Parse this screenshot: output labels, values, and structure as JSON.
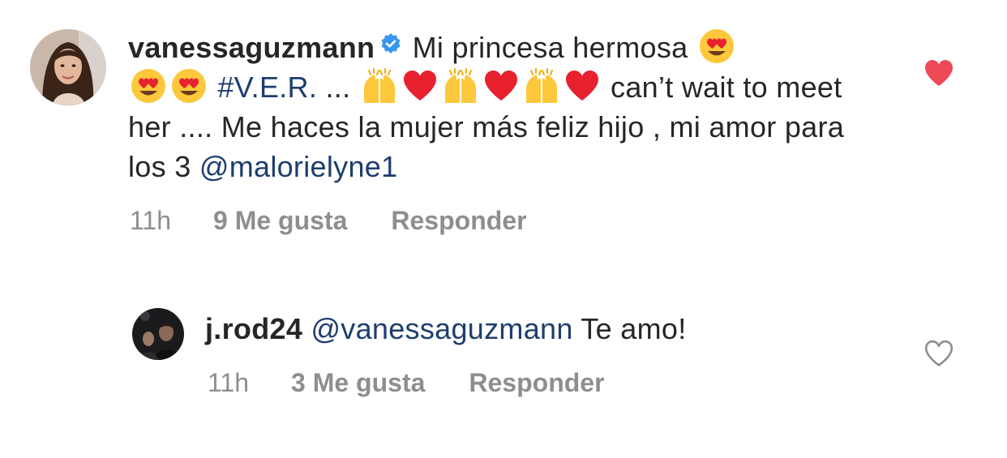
{
  "accent_colors": {
    "mention": "#1c3e6e",
    "meta_text": "#8e8e8e",
    "liked_heart": "#ed4956",
    "verified_badge": "#3897f0"
  },
  "comments": [
    {
      "username": "vanessaguzmann",
      "verified": true,
      "segments": {
        "t1": "Mi princesa hermosa",
        "hashtag": "#V.E.R.",
        "t2": "...",
        "t3": "can’t wait to meet her .... Me haces la mujer más feliz hijo , mi amor para los 3",
        "mention": "@malorielyne1"
      },
      "emoji_icons": [
        "heart-eyes-emoji",
        "raising-hands-emoji",
        "red-heart-emoji"
      ],
      "time": "11h",
      "likes": "9 Me gusta",
      "reply": "Responder",
      "liked": true
    },
    {
      "username": "j.rod24",
      "verified": false,
      "segments": {
        "mention": "@vanessaguzmann",
        "t1": "Te amo!"
      },
      "time": "11h",
      "likes": "3 Me gusta",
      "reply": "Responder",
      "liked": false
    }
  ]
}
